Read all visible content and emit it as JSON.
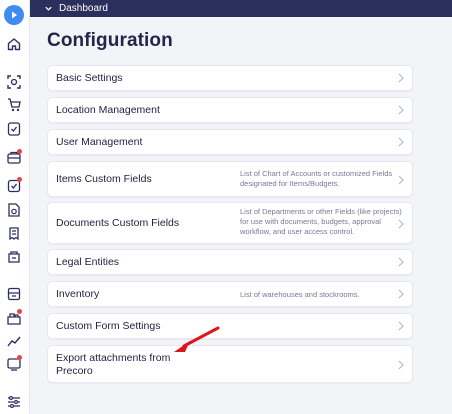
{
  "topbar": {
    "breadcrumb": "Dashboard"
  },
  "page": {
    "title": "Configuration"
  },
  "rows": [
    {
      "label": "Basic Settings",
      "desc": ""
    },
    {
      "label": "Location Management",
      "desc": ""
    },
    {
      "label": "User Management",
      "desc": ""
    },
    {
      "label": "Items Custom Fields",
      "desc": "List of Chart of Accounts or customized Fields designated for Items/Budgets."
    },
    {
      "label": "Documents Custom Fields",
      "desc": "List of Departments or other Fields (like projects) for use with documents, budgets, approval workflow, and user access control."
    },
    {
      "label": "Legal Entities",
      "desc": ""
    },
    {
      "label": "Inventory",
      "desc": "List of warehouses and stockrooms."
    },
    {
      "label": "Custom Form Settings",
      "desc": ""
    },
    {
      "label": "Export attachments from Precoro",
      "desc": ""
    }
  ],
  "sidebar": {
    "icons": [
      "home-icon",
      "scan-icon",
      "requests-icon",
      "approvals-icon",
      "purchase-orders-icon",
      "invoices-icon",
      "payments-icon",
      "receipts-icon",
      "budgets-icon",
      "inventory-icon",
      "suppliers-icon",
      "analytics-icon",
      "notifications-icon",
      "settings-icon"
    ]
  },
  "colors": {
    "topbar": "#2b2f5c",
    "accent": "#3d8cf0",
    "annotation": "#e0141b",
    "badge": "#e04848"
  }
}
